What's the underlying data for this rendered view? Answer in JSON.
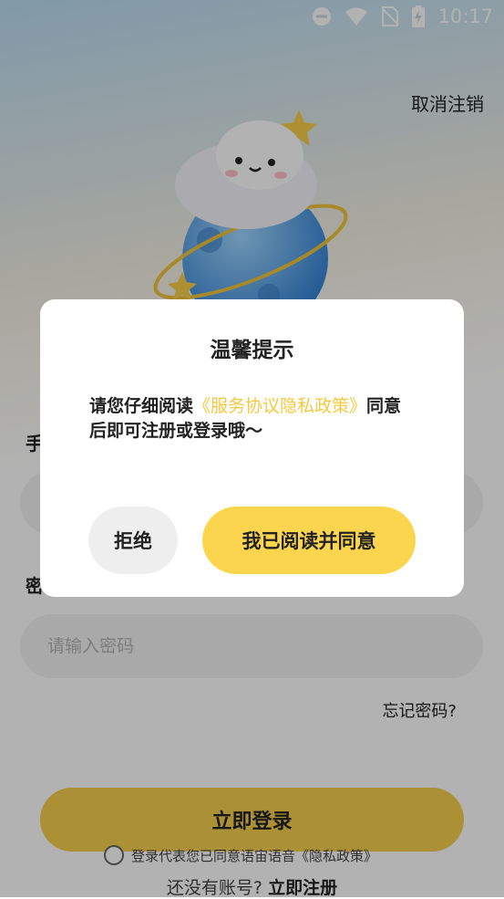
{
  "status_bar": {
    "time": "10:17"
  },
  "header": {
    "cancel_label": "取消注销"
  },
  "form": {
    "phone_label": "手",
    "password_label": "密",
    "password_placeholder": "请输入密码",
    "forgot_label": "忘记密码?",
    "login_label": "立即登录",
    "agreement_prefix": "登录代表您已同意语宙语音",
    "agreement_link": "《隐私政策》",
    "register_prompt": "还没有账号?",
    "register_link": "立即注册"
  },
  "dialog": {
    "title": "温馨提示",
    "body_prefix": "请您仔细阅读",
    "body_link": "《服务协议隐私政策》",
    "body_suffix": "同意后即可注册或登录哦～",
    "reject_label": "拒绝",
    "agree_label": "我已阅读并同意"
  },
  "colors": {
    "accent": "#fcd54f",
    "link": "#f5c93f"
  },
  "icons": [
    "dnd-icon",
    "wifi-icon",
    "no-sim-icon",
    "battery-charging-icon"
  ]
}
